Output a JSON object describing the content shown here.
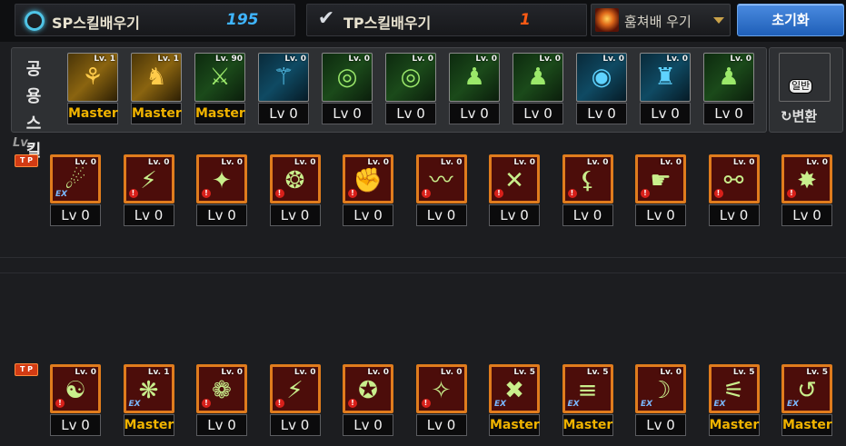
{
  "header": {
    "sp": {
      "title": "SP스킬배우기",
      "value": "195",
      "color": "#3fb5ff"
    },
    "tp": {
      "title": "TP스킬배우기",
      "value": "1",
      "color": "#ff5a14"
    },
    "dropdown": {
      "label": "훔쳐배 우기"
    },
    "reset_label": "초기화"
  },
  "common": {
    "label_line1": "공용",
    "label_line2": "스킬",
    "skills": [
      {
        "tag": "Lv. 1",
        "level": "Master",
        "style": "gold",
        "icon": "dancer-icon",
        "glyph": "⚘"
      },
      {
        "tag": "Lv. 1",
        "level": "Master",
        "style": "gold",
        "icon": "crouch-icon",
        "glyph": "♞"
      },
      {
        "tag": "Lv. 90",
        "level": "Master",
        "style": "green",
        "icon": "flex-icon",
        "glyph": "⚔"
      },
      {
        "tag": "Lv. 0",
        "level": "Lv 0",
        "style": "blue",
        "icon": "wings-icon",
        "glyph": "⚚"
      },
      {
        "tag": "Lv. 0",
        "level": "Lv 0",
        "style": "green",
        "icon": "target-icon",
        "glyph": "◎"
      },
      {
        "tag": "Lv. 0",
        "level": "Lv 0",
        "style": "green",
        "icon": "target-icon",
        "glyph": "◎"
      },
      {
        "tag": "Lv. 0",
        "level": "Lv 0",
        "style": "green",
        "icon": "bust-icon",
        "glyph": "♟"
      },
      {
        "tag": "Lv. 0",
        "level": "Lv 0",
        "style": "green",
        "icon": "bust-icon",
        "glyph": "♟"
      },
      {
        "tag": "Lv. 0",
        "level": "Lv 0",
        "style": "blue",
        "icon": "eye-icon",
        "glyph": "◉"
      },
      {
        "tag": "Lv. 0",
        "level": "Lv 0",
        "style": "blue",
        "icon": "figure-icon",
        "glyph": "♜"
      },
      {
        "tag": "Lv. 0",
        "level": "Lv 0",
        "style": "green",
        "icon": "bust-icon",
        "glyph": "♟"
      }
    ],
    "convert": {
      "icon_label": "일반",
      "label": "변환"
    }
  },
  "lv_header": "Lv.",
  "tp_tag": "T P",
  "rows": [
    [
      {
        "tag": "Lv. 0",
        "level": "Lv 0",
        "badge": "ex",
        "glyph": "☄"
      },
      {
        "tag": "Lv. 0",
        "level": "Lv 0",
        "badge": "warn",
        "glyph": "⚡"
      },
      {
        "tag": "Lv. 0",
        "level": "Lv 0",
        "badge": "warn",
        "glyph": "✦"
      },
      {
        "tag": "Lv. 0",
        "level": "Lv 0",
        "badge": "warn",
        "glyph": "❂"
      },
      {
        "tag": "Lv. 0",
        "level": "Lv 0",
        "badge": "warn",
        "glyph": "✊"
      },
      {
        "tag": "Lv. 0",
        "level": "Lv 0",
        "badge": "warn",
        "glyph": "〰"
      },
      {
        "tag": "Lv. 0",
        "level": "Lv 0",
        "badge": "warn",
        "glyph": "✕"
      },
      {
        "tag": "Lv. 0",
        "level": "Lv 0",
        "badge": "warn",
        "glyph": "⚸"
      },
      {
        "tag": "Lv. 0",
        "level": "Lv 0",
        "badge": "warn",
        "glyph": "☛"
      },
      {
        "tag": "Lv. 0",
        "level": "Lv 0",
        "badge": "warn",
        "glyph": "⚯"
      },
      {
        "tag": "Lv. 0",
        "level": "Lv 0",
        "badge": "warn",
        "glyph": "✸"
      }
    ],
    [
      {
        "tag": "Lv. 0",
        "level": "Lv 0",
        "badge": "warn",
        "glyph": "☯"
      },
      {
        "tag": "Lv. 1",
        "level": "Master",
        "badge": "ex",
        "glyph": "❋"
      },
      {
        "tag": "Lv. 0",
        "level": "Lv 0",
        "badge": "warn",
        "glyph": "❁"
      },
      {
        "tag": "Lv. 0",
        "level": "Lv 0",
        "badge": "warn",
        "glyph": "⚡"
      },
      {
        "tag": "Lv. 0",
        "level": "Lv 0",
        "badge": "warn",
        "glyph": "✪"
      },
      {
        "tag": "Lv. 0",
        "level": "Lv 0",
        "badge": "warn",
        "glyph": "✧"
      },
      {
        "tag": "Lv. 5",
        "level": "Master",
        "badge": "ex",
        "glyph": "✖"
      },
      {
        "tag": "Lv. 5",
        "level": "Master",
        "badge": "ex",
        "glyph": "≡"
      },
      {
        "tag": "Lv. 0",
        "level": "Lv 0",
        "badge": "ex",
        "glyph": "☽"
      },
      {
        "tag": "Lv. 5",
        "level": "Master",
        "badge": "ex",
        "glyph": "⚟"
      },
      {
        "tag": "Lv. 5",
        "level": "Master",
        "badge": "ex",
        "glyph": "↺"
      }
    ]
  ]
}
